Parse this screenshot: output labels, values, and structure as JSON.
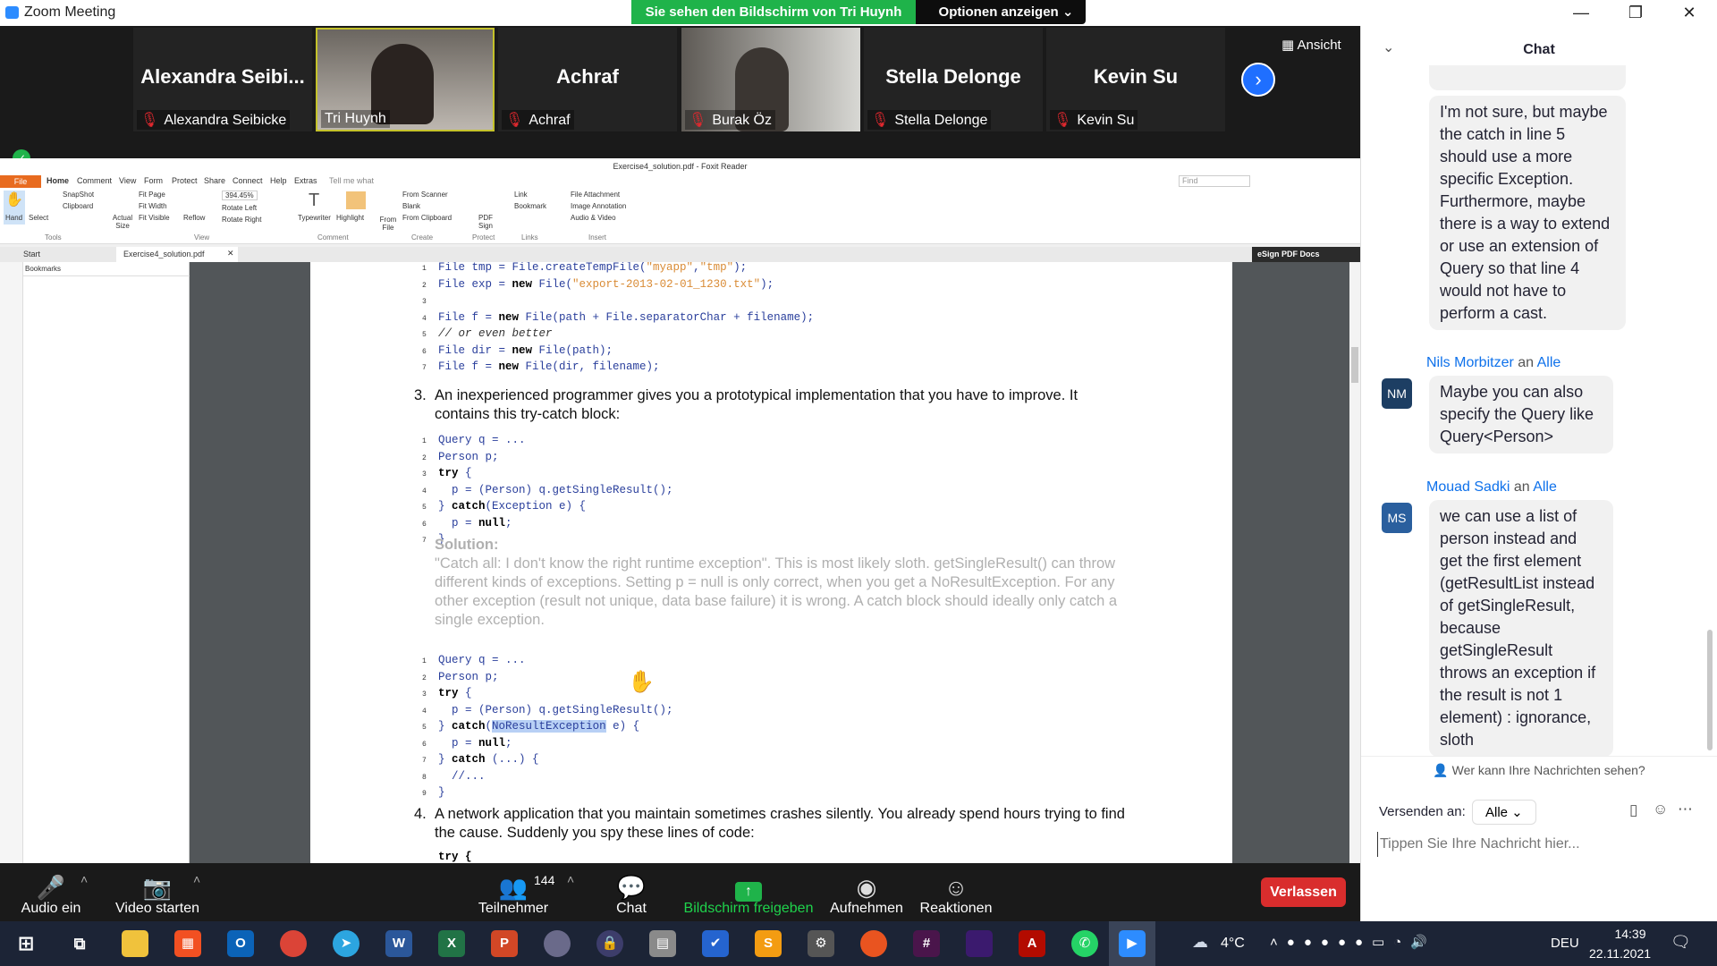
{
  "window": {
    "title": "Zoom Meeting",
    "minimize": "—",
    "restore": "❐",
    "close": "✕"
  },
  "share_banner": {
    "label": "Sie sehen den Bildschirm von Tri Huynh",
    "options": "Optionen anzeigen ⌄"
  },
  "gallery": {
    "view_label": "Ansicht",
    "tiles": [
      {
        "center": "Alexandra  Seibi...",
        "label": "Alexandra Seibicke",
        "muted": true,
        "video": false
      },
      {
        "center": "",
        "label": "Tri Huynh",
        "muted": false,
        "video": true
      },
      {
        "center": "Achraf",
        "label": "Achraf",
        "muted": true,
        "video": false
      },
      {
        "center": "",
        "label": "Burak Öz",
        "muted": true,
        "video": true
      },
      {
        "center": "Stella Delonge",
        "label": "Stella Delonge",
        "muted": true,
        "video": false
      },
      {
        "center": "Kevin Su",
        "label": "Kevin Su",
        "muted": true,
        "video": false
      }
    ]
  },
  "foxit": {
    "title": "Exercise4_solution.pdf - Foxit Reader",
    "menu": [
      "File",
      "Home",
      "Comment",
      "View",
      "Form",
      "Protect",
      "Share",
      "Connect",
      "Help",
      "Extras",
      "Tell me what"
    ],
    "find_placeholder": "Find",
    "ribbon": {
      "hand": "Hand",
      "select": "Select",
      "snapshot": "SnapShot",
      "clipboard": "Clipboard",
      "group_tools": "Tools",
      "actual_size": "Actual Size",
      "fit_page": "Fit Page",
      "fit_width": "Fit Width",
      "fit_visible": "Fit Visible",
      "reflow": "Reflow",
      "zoom": "394.45%",
      "rotate_left": "Rotate Left",
      "rotate_right": "Rotate Right",
      "group_view": "View",
      "typewriter": "Typewriter",
      "highlight": "Highlight",
      "group_comment": "Comment",
      "from_file": "From File",
      "from_scanner": "From Scanner",
      "blank": "Blank",
      "from_clipboard": "From Clipboard",
      "group_create": "Create",
      "pdf_sign": "PDF Sign",
      "group_protect": "Protect",
      "link": "Link",
      "bookmark": "Bookmark",
      "group_links": "Links",
      "file_attachment": "File Attachment",
      "image_annotation": "Image Annotation",
      "audio_video": "Audio & Video",
      "group_insert": "Insert"
    },
    "tabs": [
      "Start",
      "Exercise4_solution.pdf"
    ],
    "esign": "eSign PDF Docs",
    "sidebar_title": "Bookmarks",
    "doc": {
      "code1": [
        {
          "n": "1",
          "parts": [
            [
              "t",
              "File tmp = File.createTempFile("
            ],
            [
              "s",
              "\"myapp\""
            ],
            [
              "t",
              ","
            ],
            [
              "s",
              "\"tmp\""
            ],
            [
              "t",
              ");"
            ]
          ]
        },
        {
          "n": "2",
          "parts": [
            [
              "t",
              "File exp = "
            ],
            [
              "k",
              "new"
            ],
            [
              "t",
              " File("
            ],
            [
              "s",
              "\"export-2013-02-01_1230.txt\""
            ],
            [
              "t",
              ");"
            ]
          ]
        },
        {
          "n": "3",
          "parts": []
        },
        {
          "n": "4",
          "parts": [
            [
              "t",
              "File f = "
            ],
            [
              "k",
              "new"
            ],
            [
              "t",
              " File(path + File.separatorChar + filename);"
            ]
          ]
        },
        {
          "n": "5",
          "parts": [
            [
              "c",
              "// or even better"
            ]
          ]
        },
        {
          "n": "6",
          "parts": [
            [
              "t",
              "File dir = "
            ],
            [
              "k",
              "new"
            ],
            [
              "t",
              " File(path);"
            ]
          ]
        },
        {
          "n": "7",
          "parts": [
            [
              "t",
              "File f = "
            ],
            [
              "k",
              "new"
            ],
            [
              "t",
              " File(dir, filename);"
            ]
          ]
        }
      ],
      "q3_num": "3.",
      "q3_text": "An inexperienced programmer gives you a prototypical implementation that you have to improve.  It contains this try-catch block:",
      "code2": [
        {
          "n": "1",
          "parts": [
            [
              "t",
              "Query q = ..."
            ]
          ]
        },
        {
          "n": "2",
          "parts": [
            [
              "t",
              "Person p;"
            ]
          ]
        },
        {
          "n": "3",
          "parts": [
            [
              "k",
              "try"
            ],
            [
              "t",
              " {"
            ]
          ]
        },
        {
          "n": "4",
          "parts": [
            [
              "t",
              "  p = (Person) q.getSingleResult();"
            ]
          ]
        },
        {
          "n": "5",
          "parts": [
            [
              "t",
              "} "
            ],
            [
              "k",
              "catch"
            ],
            [
              "t",
              "(Exception e) {"
            ]
          ]
        },
        {
          "n": "6",
          "parts": [
            [
              "t",
              "  p = "
            ],
            [
              "k",
              "null"
            ],
            [
              "t",
              ";"
            ]
          ]
        },
        {
          "n": "7",
          "parts": [
            [
              "t",
              "}"
            ]
          ]
        }
      ],
      "solution_title": "Solution:",
      "solution_text": "\"Catch all: I don't know the right runtime exception\". This is most likely sloth. getSingleResult() can throw different kinds of exceptions. Setting p = null is only correct, when you get a NoResultException. For any other exception (result not unique, data base failure) it is wrong.  A catch block should ideally only catch a single exception.",
      "code3": [
        {
          "n": "1",
          "parts": [
            [
              "t",
              "Query q = ..."
            ]
          ]
        },
        {
          "n": "2",
          "parts": [
            [
              "t",
              "Person p;"
            ]
          ]
        },
        {
          "n": "3",
          "parts": [
            [
              "k",
              "try"
            ],
            [
              "t",
              " {"
            ]
          ]
        },
        {
          "n": "4",
          "parts": [
            [
              "t",
              "  p = (Person) q.getSingleResult();"
            ]
          ]
        },
        {
          "n": "5",
          "parts": [
            [
              "t",
              "} "
            ],
            [
              "k",
              "catch"
            ],
            [
              "t",
              "("
            ],
            [
              "h",
              "NoResultException"
            ],
            [
              "t",
              " e) {"
            ]
          ]
        },
        {
          "n": "6",
          "parts": [
            [
              "t",
              "  p = "
            ],
            [
              "k",
              "null"
            ],
            [
              "t",
              ";"
            ]
          ]
        },
        {
          "n": "7",
          "parts": [
            [
              "t",
              "} "
            ],
            [
              "k",
              "catch"
            ],
            [
              "t",
              " (...) {"
            ]
          ]
        },
        {
          "n": "8",
          "parts": [
            [
              "t",
              "  //..."
            ]
          ]
        },
        {
          "n": "9",
          "parts": [
            [
              "t",
              "}"
            ]
          ]
        }
      ],
      "q4_num": "4.",
      "q4_text": "A network application that you maintain sometimes crashes silently. You already spend hours trying to find the cause.  Suddenly you spy these lines of code:",
      "code4_first": "try {"
    }
  },
  "chat": {
    "title": "Chat",
    "prev_message": "I'm not sure, but maybe the catch in line 5 should use a more specific Exception. Furthermore, maybe there is a way to extend or use an extension of Query so that line 4 would not have to perform a cast.",
    "messages": [
      {
        "initials": "NM",
        "sender": "Nils Morbitzer",
        "an": "an",
        "to": "Alle",
        "text": "Maybe you can also specify the Query like Query<Person>"
      },
      {
        "initials": "MS",
        "sender": "Mouad Sadki",
        "an": "an",
        "to": "Alle",
        "text": "we can use a list of person instead and get the first element (getResultList instead of getSingleResult, because getSingleResult throws an exception if the result is not 1 element) : ignorance, sloth"
      }
    ],
    "who_can_see": "Wer kann Ihre Nachrichten sehen?",
    "send_to_label": "Versenden an:",
    "send_to_value": "Alle",
    "input_placeholder": "Tippen Sie Ihre Nachricht hier..."
  },
  "toolbar": {
    "audio": "Audio ein",
    "video": "Video starten",
    "participants": "Teilnehmer",
    "participants_count": "144",
    "chat": "Chat",
    "share": "Bildschirm freigeben",
    "record": "Aufnehmen",
    "reactions": "Reaktionen",
    "leave": "Verlassen"
  },
  "taskbar": {
    "weather": "4°C",
    "lang": "DEU",
    "time": "14:39",
    "date": "22.11.2021"
  }
}
